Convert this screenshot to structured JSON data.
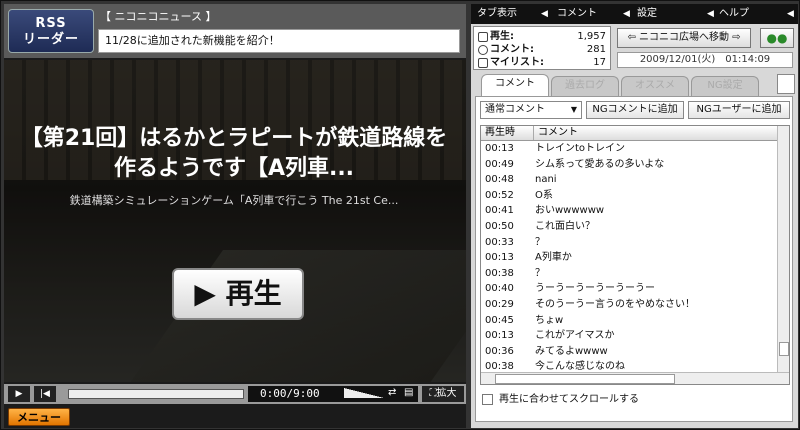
{
  "header": {
    "logo_line1": "RSS",
    "logo_line2": "リーダー",
    "channel": "【 ニコニコニュース 】",
    "news_headline": "11/28に追加された新機能を紹介！"
  },
  "video": {
    "title": "【第21回】はるかとラピートが鉄道路線を作るようです【A列車...",
    "subtitle": "鉄道構築シミュレーションゲーム「A列車で行こう The 21st Ce...",
    "play_label": "▶ 再生"
  },
  "controls": {
    "time": "0:00/",
    "duration": "9:00",
    "expand_label": "拡大",
    "menu_label": "メニュー",
    "progress": 0.0
  },
  "topmenu": {
    "items": [
      "タブ表示",
      "コメント",
      "設定",
      "ヘルプ"
    ]
  },
  "stats": {
    "play_label": "再生:",
    "play_value": "1,957",
    "comment_label": "コメント:",
    "comment_value": "281",
    "mylist_label": "マイリスト:",
    "mylist_value": "17"
  },
  "plaza_button": "ニコニコ広場へ移動",
  "datetime": "2009/12/01(火)　01:14:09",
  "tabs": [
    "コメント",
    "過去ログ",
    "オススメ",
    "NG設定"
  ],
  "comment_pane": {
    "select_value": "通常コメント",
    "ng_comment_btn": "NGコメントに追加",
    "ng_user_btn": "NGユーザーに追加",
    "col_time": "再生時",
    "col_comment": "コメント",
    "rows": [
      {
        "time": "00:13",
        "text": "トレインtoトレイン"
      },
      {
        "time": "00:49",
        "text": "シム系って愛あるの多いよな"
      },
      {
        "time": "00:48",
        "text": "nani"
      },
      {
        "time": "00:52",
        "text": "O系"
      },
      {
        "time": "00:41",
        "text": "おいwwwwww"
      },
      {
        "time": "00:50",
        "text": "これ面白い？"
      },
      {
        "time": "00:33",
        "text": "？"
      },
      {
        "time": "00:13",
        "text": "A列車か"
      },
      {
        "time": "00:38",
        "text": "？"
      },
      {
        "time": "00:40",
        "text": "うーうーうーうーうーうー"
      },
      {
        "time": "00:29",
        "text": "そのうーうー言うのをやめなさい！"
      },
      {
        "time": "00:45",
        "text": "ちょw"
      },
      {
        "time": "00:13",
        "text": "これがアイマスか"
      },
      {
        "time": "00:36",
        "text": "みてるよwwww"
      },
      {
        "time": "00:38",
        "text": "今こんな感じなのね"
      }
    ],
    "scroll_checkbox": "再生に合わせてスクロールする"
  }
}
